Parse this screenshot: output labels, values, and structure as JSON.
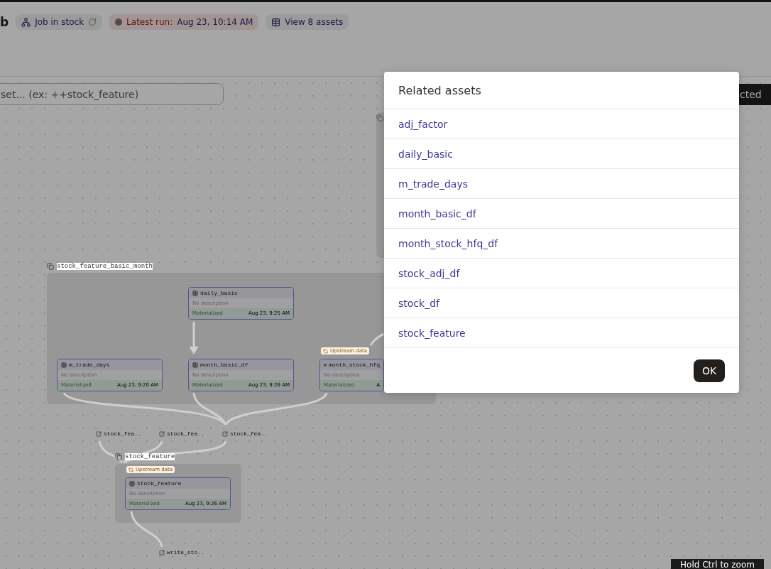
{
  "header": {
    "title": "b",
    "job_pill": "Job in stock",
    "run_pill": {
      "label": "Latest run:",
      "time": "Aug 23, 10:14 AM"
    },
    "assets_pill": "View 8 assets"
  },
  "search": {
    "placeholder": "set... (ex: ++stock_feature)"
  },
  "right_button": "cted",
  "groups": [
    {
      "kind": "hidden_label"
    },
    {
      "kind": "labeled",
      "label": "stock_feature_basic_month"
    },
    {
      "kind": "labeled",
      "label": "stock_feature"
    }
  ],
  "nodes": [
    {
      "name": "daily_basic",
      "description": "No description",
      "status": "Materialized",
      "time": "Aug 23, 9:25 AM"
    },
    {
      "name": "m_trade_days",
      "description": "No description",
      "status": "Materialized",
      "time": "Aug 23, 9:20 AM"
    },
    {
      "name": "month_basic_df",
      "description": "No description",
      "status": "Materialized",
      "time": "Aug 23, 9:26 AM"
    },
    {
      "name": "month_stock_hfq",
      "description": "No description",
      "status": "Materialized",
      "time": "A",
      "badge": "Upstream data"
    },
    {
      "name": "stock_feature",
      "description": "No description",
      "status": "Materialized",
      "time": "Aug 23, 9:26 AM",
      "badge": "Upstream data"
    }
  ],
  "ops": [
    "stock_fea..",
    "stock_fea..",
    "stock_fea..",
    "write_sto.."
  ],
  "modal": {
    "title": "Related assets",
    "items": [
      "adj_factor",
      "daily_basic",
      "m_trade_days",
      "month_basic_df",
      "month_stock_hfq_df",
      "stock_adj_df",
      "stock_df",
      "stock_feature"
    ],
    "ok": "OK"
  },
  "tooltip": "Hold Ctrl to zoom"
}
